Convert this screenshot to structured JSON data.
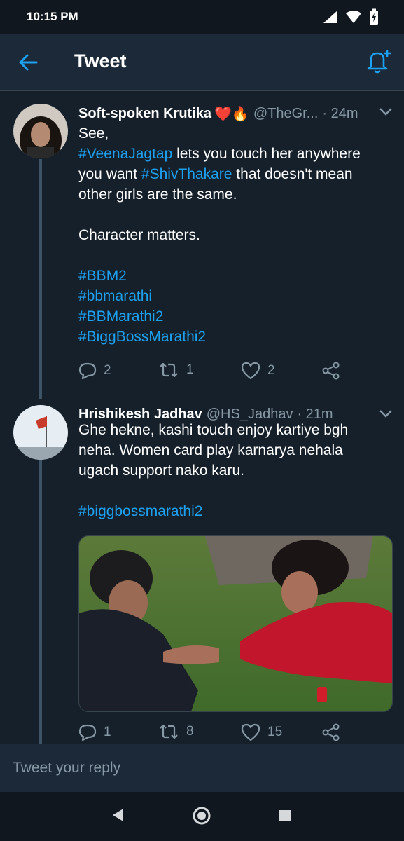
{
  "status_bar": {
    "time": "10:15 PM"
  },
  "header": {
    "title": "Tweet"
  },
  "tweets": [
    {
      "name": "Soft-spoken Krutika",
      "emoji": "❤️🔥",
      "handle": "@TheGr...",
      "time": "· 24m",
      "lines": [
        {
          "parts": [
            {
              "t": "See,",
              "tag": false
            }
          ]
        },
        {
          "parts": [
            {
              "t": "#VeenaJagtap",
              "tag": true
            },
            {
              "t": " lets you touch her anywhere you want ",
              "tag": false
            },
            {
              "t": "#ShivThakare",
              "tag": true
            },
            {
              "t": " that doesn't mean other girls are the same.",
              "tag": false
            }
          ]
        },
        {
          "parts": [
            {
              "t": "",
              "tag": false
            }
          ]
        },
        {
          "parts": [
            {
              "t": "Character matters.",
              "tag": false
            }
          ]
        },
        {
          "parts": [
            {
              "t": "",
              "tag": false
            }
          ]
        },
        {
          "parts": [
            {
              "t": "#BBM2",
              "tag": true
            }
          ]
        },
        {
          "parts": [
            {
              "t": "#bbmarathi",
              "tag": true
            }
          ]
        },
        {
          "parts": [
            {
              "t": "#BBMarathi2",
              "tag": true
            }
          ]
        },
        {
          "parts": [
            {
              "t": "#BiggBossMarathi2",
              "tag": true
            }
          ]
        }
      ],
      "replies": "2",
      "retweets": "1",
      "likes": "2"
    },
    {
      "name": "Hrishikesh Jadhav",
      "handle": "@HS_Jadhav",
      "time": "· 21m",
      "lines": [
        {
          "parts": [
            {
              "t": "Ghe hekne, kashi touch enjoy kartiye bgh neha. Women card play karnarya nehala ugach support nako karu.",
              "tag": false
            }
          ]
        },
        {
          "parts": [
            {
              "t": "",
              "tag": false
            }
          ]
        },
        {
          "parts": [
            {
              "t": "#biggbossmarathi2",
              "tag": true
            }
          ]
        }
      ],
      "replies": "1",
      "retweets": "8",
      "likes": "15"
    }
  ],
  "reply_bar": {
    "placeholder": "Tweet your reply"
  },
  "colors": {
    "bg": "#15202b",
    "accent": "#1da1f2",
    "muted": "#8899a6"
  },
  "icons": [
    "back-arrow-icon",
    "notification-bell-plus-icon",
    "caret-down-icon",
    "reply-icon",
    "retweet-icon",
    "like-icon",
    "share-icon"
  ]
}
